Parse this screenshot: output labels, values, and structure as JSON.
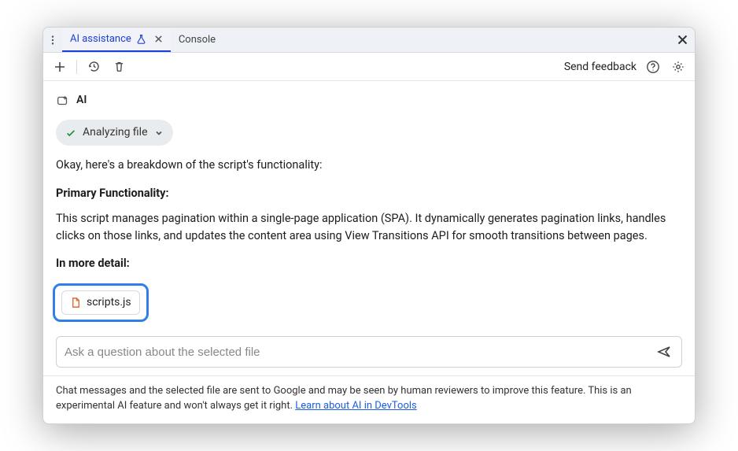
{
  "tabs": {
    "active": {
      "label": "AI assistance"
    },
    "console": {
      "label": "Console"
    }
  },
  "toolbar": {
    "feedback": "Send feedback"
  },
  "ai": {
    "label": "AI",
    "chip_label": "Analyzing file"
  },
  "response": {
    "intro": "Okay, here's a breakdown of the script's functionality:",
    "h1": "Primary Functionality:",
    "p1": "This script manages pagination within a single-page application (SPA). It dynamically generates pagination links, handles clicks on those links, and updates the content area using View Transitions API for smooth transitions between pages.",
    "h2": "In more detail:"
  },
  "file": {
    "name": "scripts.js"
  },
  "input": {
    "placeholder": "Ask a question about the selected file"
  },
  "footer": {
    "text": "Chat messages and the selected file are sent to Google and may be seen by human reviewers to improve this feature. This is an experimental AI feature and won't always get it right. ",
    "link": "Learn about AI in DevTools"
  }
}
